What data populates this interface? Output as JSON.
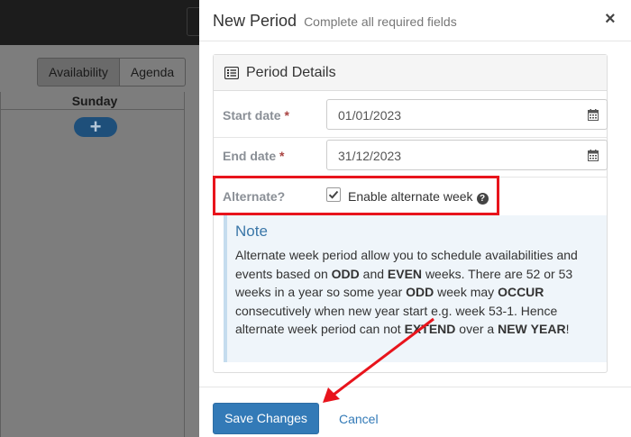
{
  "background": {
    "view_buttons": [
      "Availability",
      "Agenda"
    ],
    "day_header": "Sunday",
    "add_symbol": "+"
  },
  "modal": {
    "title": "New Period",
    "subtitle": "Complete all required fields",
    "close_symbol": "×",
    "panel_title": "Period Details",
    "start_date": {
      "label": "Start date",
      "required_mark": "*",
      "value": "01/01/2023"
    },
    "end_date": {
      "label": "End date",
      "required_mark": "*",
      "value": "31/12/2023"
    },
    "alternate": {
      "label": "Alternate?",
      "checkbox_label": "Enable alternate week",
      "checked": true,
      "help_symbol": "?"
    },
    "note": {
      "title": "Note",
      "text": "Alternate week period allow you to schedule availabilities and events based on ODD and EVEN weeks. There are 52 or 53 weeks in a year so some year ODD week may OCCUR consecutively when new year start e.g. week 53-1. Hence alternate week period can not EXTEND over a NEW YEAR!"
    },
    "footer": {
      "save_label": "Save Changes",
      "cancel_label": "Cancel"
    }
  },
  "annotation_color": "#e8141c",
  "icons": [
    "list-icon",
    "calendar-icon",
    "check-icon",
    "question-circle-icon",
    "close-icon",
    "plus-icon"
  ]
}
